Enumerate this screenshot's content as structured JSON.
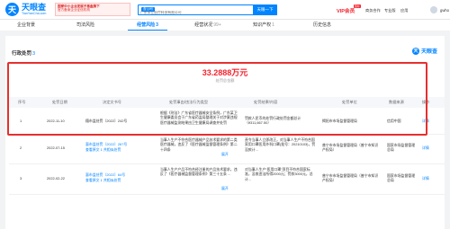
{
  "header": {
    "logo_glyph": "天",
    "logo_name": "天眼查",
    "logo_domain": "TianYanCha.com",
    "banner_line1": "国家中小企业发展子基金旗下",
    "banner_line2": "官方备案企业征信机构",
    "search_tag": "查公司",
    "search_value": "广东本立医疗科技有限公司",
    "search_button": "天眼一下",
    "vip": "VIP会员",
    "badge": "限时",
    "links": [
      "商务合作",
      "专业版",
      "应用",
      "gwho"
    ]
  },
  "tabs": [
    {
      "label": "企业背景",
      "count": ""
    },
    {
      "label": "司法风险",
      "count": ""
    },
    {
      "label": "经营风险",
      "count": "3"
    },
    {
      "label": "经营状况",
      "count": "99+"
    },
    {
      "label": "知识产权",
      "count": "1"
    },
    {
      "label": "历史信息",
      "count": ""
    }
  ],
  "section": {
    "title": "行政处罚",
    "count": "3",
    "watermark": "天眼查",
    "watermark_glyph": "天",
    "total_amount": "33.2888万元",
    "total_label": "处罚总金额"
  },
  "table": {
    "columns": [
      "序号",
      "处罚日期",
      "决定文书号",
      "处罚事由/违法行为类型",
      "处罚结果/内容",
      "处罚单位",
      "数据来源",
      "操作"
    ],
    "rows": [
      {
        "index": "1",
        "date": "2022-11-10",
        "doc_no": "穗市监处罚〔2022〕242号",
        "reason": "根据《刑法》广东省医疗器械安全条例，广东某卫生健康委员会于广东省药监局整理关于对涉案违规医疗器械监测结果由卫生健康局调查并处罚",
        "reason_more": "",
        "result": "罚款人民币的处罚行政处罚金额总计（¥311,667.50）",
        "authority": "揭阳市市场监督管理局",
        "source": "信用中国",
        "action": "详情"
      },
      {
        "index": "2",
        "date": "2022-07-15",
        "doc_no": "惠市监处罚〔2022〕267号",
        "doc_more": "查看原文 1 共相似处罚",
        "reason": "当事人生产不符合医疗器械产品技术要求的第二类医疗器械，违反了《医疗器械监督管理条例》第二十四条",
        "reason_more": "展开",
        "result": "责令当事人立即改正，对当事人生产不符合国家用口罩医用外科口罩(批号：20210103)，罚没款计...",
        "authority": "普宁市市场监督管理局（普宁市知识产权局）",
        "source": "国家市场监督管理总局",
        "action": "详情"
      },
      {
        "index": "3",
        "date": "2022-02-22",
        "doc_no": "惠市监处罚〔2022〕64号",
        "doc_more": "查看原文 1 共相似处罚",
        "reason": "当事人生产产品不符合经注册的产品技术要求，违反了《医疗器械监督管理条例》第三十五条 ...",
        "reason_more": "展开",
        "result": "对当事人生产“医用口罩”项目不符合国家标准，没收违法所得2000元；罚款3000元，总计...",
        "authority": "普宁市市场监督管理局（普宁市知识产权局）",
        "source": "国家市场监督管理总局",
        "action": "详情"
      }
    ]
  }
}
